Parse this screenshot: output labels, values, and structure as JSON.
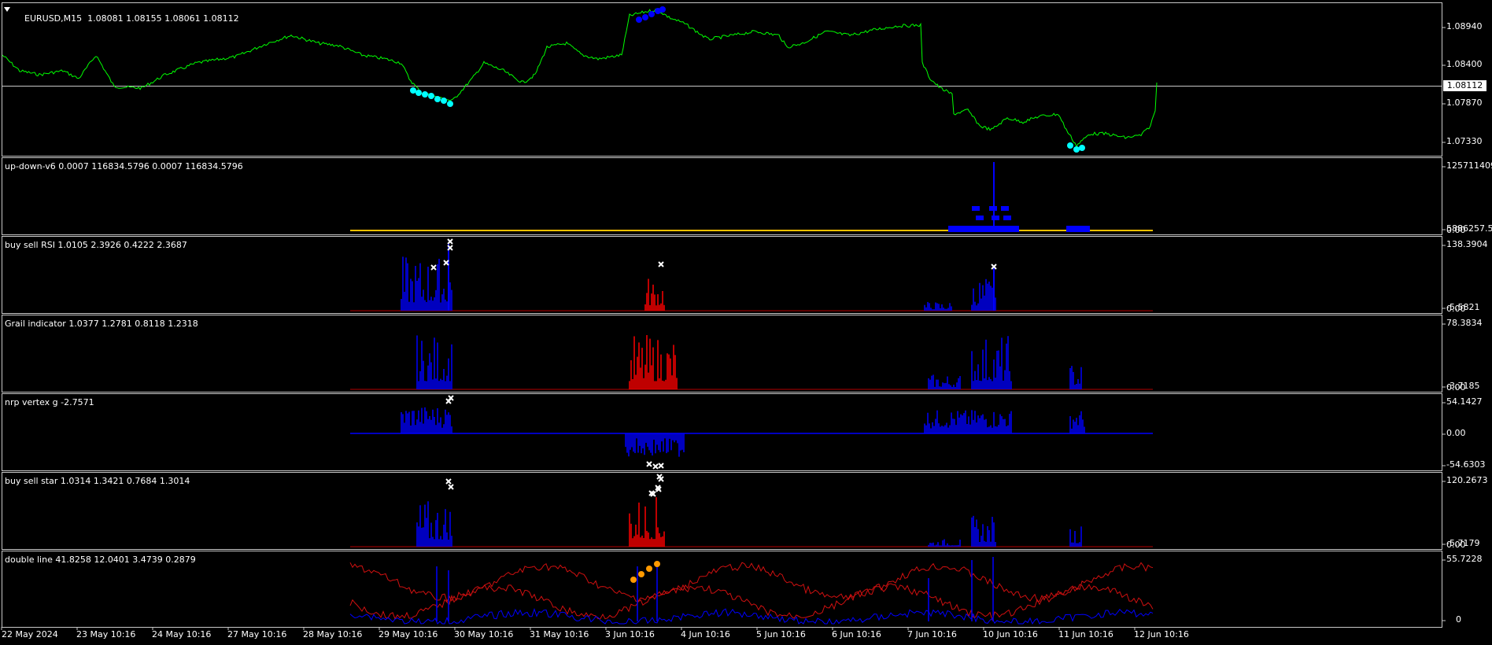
{
  "main": {
    "symbol_label": "EURUSD,M15",
    "ohlc_label": "1.08081 1.08155 1.08061 1.08112",
    "price_ticks": [
      "1.08940",
      "1.08400",
      "1.07870",
      "1.07330"
    ],
    "current_price": "1.08112",
    "price_range": [
      1.0697,
      1.0931
    ],
    "line_color": "#00ff00"
  },
  "panes": [
    {
      "id": "updown",
      "label": "up-down-v6 0.0007 116834.5796 0.0007 116834.5796",
      "ticks": [
        "125711409",
        "5886257.5",
        "0.00"
      ]
    },
    {
      "id": "rsi",
      "label": "buy sell RSI 1.0105 2.3926 0.4222 2.3687",
      "ticks": [
        "138.3904",
        "-5.5821",
        "0.00"
      ]
    },
    {
      "id": "grail",
      "label": "Grail indicator 1.0377 1.2781 0.8118 1.2318",
      "ticks": [
        "78.3834",
        "-3.7185",
        "0.00"
      ]
    },
    {
      "id": "nrp",
      "label": "nrp vertex g -2.7571",
      "ticks": [
        "54.1427",
        "0.00",
        "-54.6303"
      ]
    },
    {
      "id": "star",
      "label": "buy sell star 1.0314 1.3421 0.7684 1.3014",
      "ticks": [
        "120.2673",
        "-5.7179",
        "0.00"
      ]
    },
    {
      "id": "double",
      "label": "double line 41.8258 12.0401 3.4739 0.2879",
      "ticks": [
        "55.7228",
        "0"
      ]
    }
  ],
  "dates": [
    "22 May 2024",
    "23 May 10:16",
    "24 May 10:16",
    "27 May 10:16",
    "28 May 10:16",
    "29 May 10:16",
    "30 May 10:16",
    "31 May 10:16",
    "3 Jun 10:16",
    "4 Jun 10:16",
    "5 Jun 10:16",
    "6 Jun 10:16",
    "7 Jun 10:16",
    "10 Jun 10:16",
    "11 Jun 10:16",
    "12 Jun 10:16"
  ],
  "colors": {
    "bull": "#0000ff",
    "bear": "#ff0000",
    "signal": "#ffffff",
    "level": "#ffc000",
    "mark": "#00ffff",
    "orange": "#ff9900"
  }
}
